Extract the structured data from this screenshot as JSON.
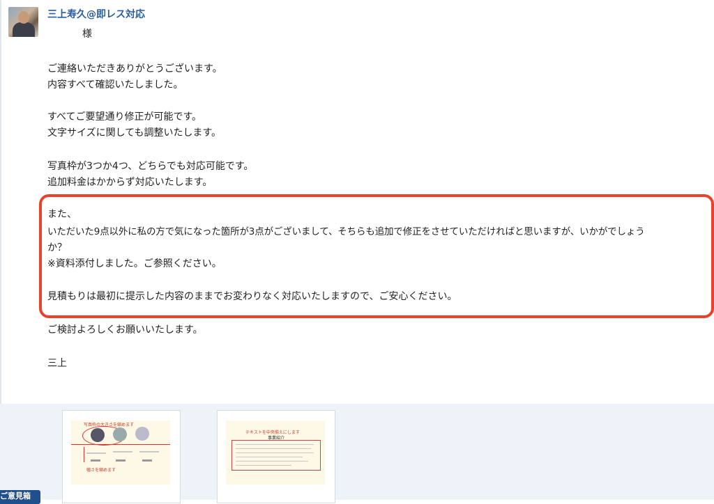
{
  "message": {
    "sender": "三上寿久@即レス対応",
    "salutation": "様",
    "lines": [
      "ご連絡いただきありがとうございます。",
      "内容すべて確認いたしました。",
      "すべてご要望通り修正が可能です。",
      "文字サイズに関しても調整いたします。",
      "写真枠が3つか4つ、どちらでも対応可能です。",
      "追加料金はかからず対応いたします。",
      "また、",
      "いただいた9点以外に私の方で気になった箇所が3点がございまして、そちらも追加で修正をさせていただければと思いますが、いかがでしょう",
      "か？",
      "※資料添付しました。ご参照ください。",
      "見積もりは最初に提示した内容のままでお変わりなく対応いたしますので、ご安心ください。",
      "ご検討よろしくお願いいたします。",
      "三上"
    ]
  },
  "attachments": [
    {
      "title": "写真枠の大きさを縮めます",
      "caption": "幅さを縮めます"
    },
    {
      "title": "テキストを中央揃えにします",
      "heading": "事業紹介"
    }
  ],
  "bottom_tag": "ご意見箱",
  "colors": {
    "accent": "#2a5d9f",
    "highlight": "#e8412c",
    "attach_bg": "#edf3f8"
  }
}
